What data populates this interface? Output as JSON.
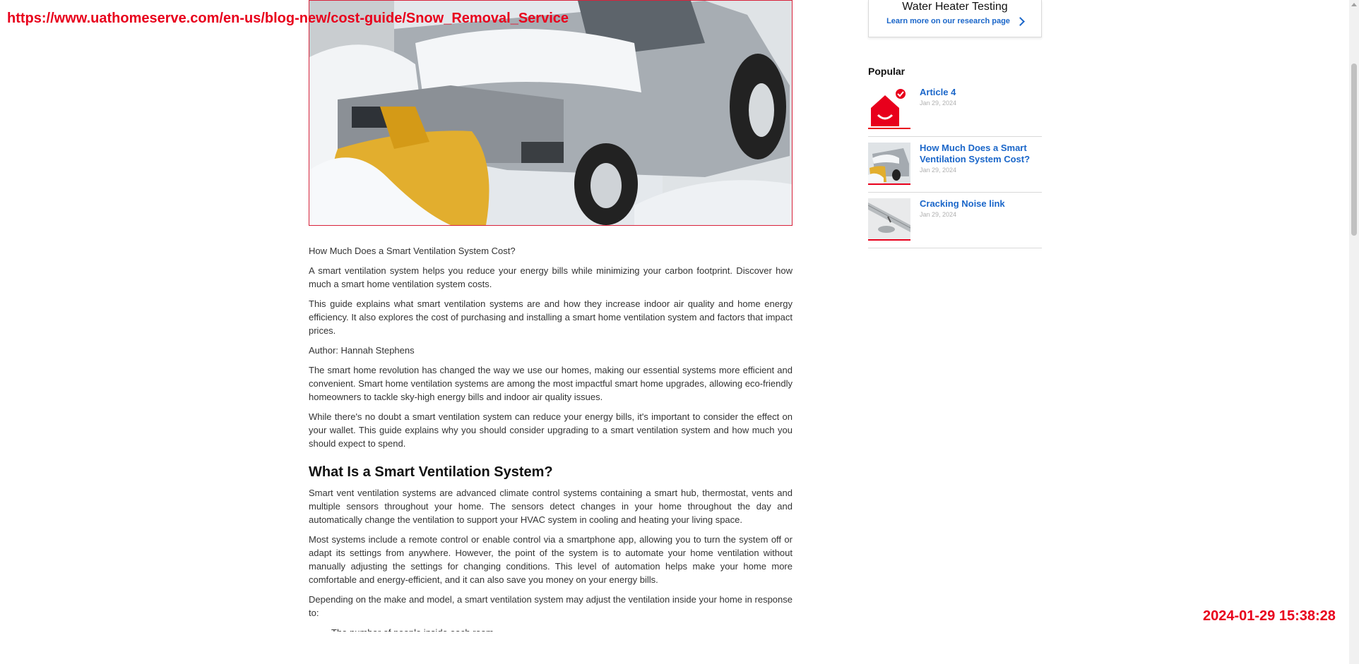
{
  "overlay": {
    "url": "https://www.uathomeserve.com/en-us/blog-new/cost-guide/Snow_Removal_Service",
    "timestamp": "2024-01-29 15:38:28"
  },
  "article": {
    "caption": "How Much Does a Smart Ventilation System Cost?",
    "paragraphs_intro": [
      "A smart ventilation system helps you reduce your energy bills while minimizing your carbon footprint. Discover how much a smart home ventilation system costs.",
      "This guide explains what smart ventilation systems are and how they increase indoor air quality and home energy efficiency. It also explores the cost of purchasing and installing a smart home ventilation system and factors that impact prices.",
      "Author: Hannah Stephens",
      "The smart home revolution has changed the way we use our homes, making our essential systems more efficient and convenient. Smart home ventilation systems are among the most impactful smart home upgrades, allowing eco-friendly homeowners to tackle sky-high energy bills and indoor air quality issues.",
      "While there's no doubt a smart ventilation system can reduce your energy bills, it's important to consider the effect on your wallet. This guide explains why you should consider upgrading to a smart ventilation system and how much you should expect to spend."
    ],
    "section_heading": "What Is a Smart Ventilation System?",
    "paragraphs_section": [
      "Smart vent ventilation systems are advanced climate control systems containing a smart hub, thermostat, vents and multiple sensors throughout your home. The sensors detect changes in your home throughout the day and automatically change the ventilation to support your HVAC system in cooling and heating your living space.",
      "Most systems include a remote control or enable control via a smartphone app, allowing you to turn the system off or adapt its settings from anywhere. However, the point of the system is to automate your home ventilation without manually adjusting the settings for changing conditions. This level of automation helps make your home more comfortable and energy-efficient, and it can also save you money on your energy bills.",
      "Depending on the make and model, a smart ventilation system may adjust the ventilation inside your home in response to:"
    ],
    "list_first_item": "The number of people inside each room"
  },
  "sidebar": {
    "promo_title": "Water Heater Testing",
    "promo_link": "Learn more on our research page",
    "popular_heading": "Popular",
    "popular": [
      {
        "title": "Article 4",
        "date": "Jan 29, 2024",
        "thumb": "house-logo-icon"
      },
      {
        "title": "How Much Does a Smart Ventilation System Cost?",
        "date": "Jan 29, 2024",
        "thumb": "snowplow-photo"
      },
      {
        "title": "Cracking Noise link",
        "date": "Jan 29, 2024",
        "thumb": "pipe-photo"
      }
    ]
  },
  "colors": {
    "accent_red": "#e8001c",
    "link_blue": "#1a66c9"
  }
}
